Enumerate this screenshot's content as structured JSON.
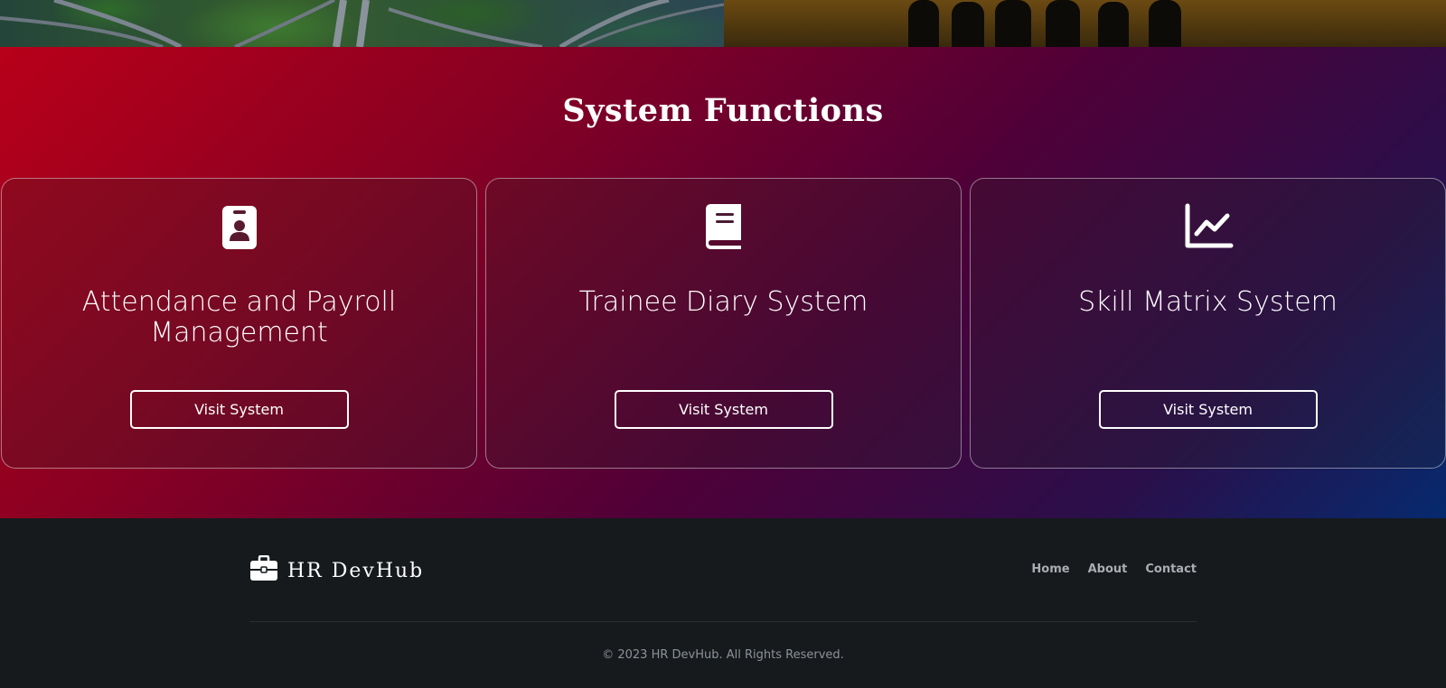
{
  "section": {
    "title": "System Functions"
  },
  "cards": [
    {
      "icon": "id-badge-icon",
      "title": "Attendance and Payroll Management",
      "button": "Visit System"
    },
    {
      "icon": "book-icon",
      "title": "Trainee Diary System",
      "button": "Visit System"
    },
    {
      "icon": "line-chart-icon",
      "title": "Skill Matrix System",
      "button": "Visit System"
    }
  ],
  "footer": {
    "brand": "HR DevHub",
    "brand_icon": "briefcase-icon",
    "nav": [
      "Home",
      "About",
      "Contact"
    ],
    "copyright": "© 2023 HR DevHub. All Rights Reserved."
  },
  "colors": {
    "gradient_start": "#b8001a",
    "gradient_mid": "#4f0038",
    "gradient_end": "#062a6e",
    "footer_bg": "#161a1d"
  }
}
